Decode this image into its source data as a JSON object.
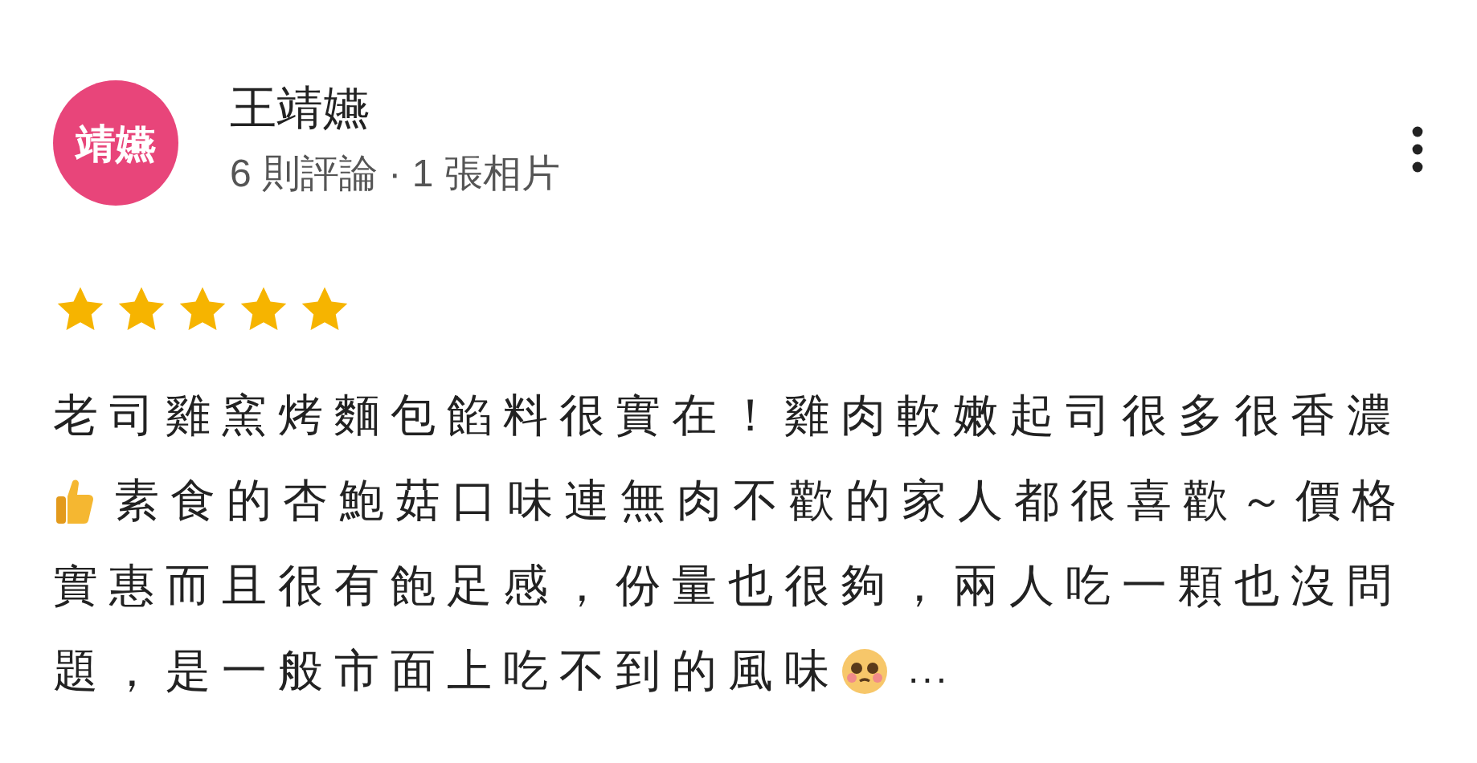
{
  "reviewer": {
    "avatar_text": "靖嬿",
    "name": "王靖嬿",
    "meta": "6 則評論 · 1 張相片"
  },
  "review": {
    "stars": 5,
    "lines": [
      [
        {
          "kind": "text",
          "text": "老司雞窯烤麵包餡料很實在！雞肉軟嫩起司很多很香濃"
        }
      ],
      [
        {
          "kind": "thumbsup"
        },
        {
          "kind": "text",
          "text": "素食的杏鮑菇口味連無肉不歡的家人都很喜歡～價格"
        }
      ],
      [
        {
          "kind": "text",
          "text": "實惠而且很有飽足感，份量也很夠，兩人吃一顆也沒問"
        }
      ],
      [
        {
          "kind": "text",
          "text": "題，是一般市面上吃不到的風味"
        },
        {
          "kind": "teary"
        },
        {
          "kind": "more",
          "text": "..."
        }
      ]
    ]
  }
}
